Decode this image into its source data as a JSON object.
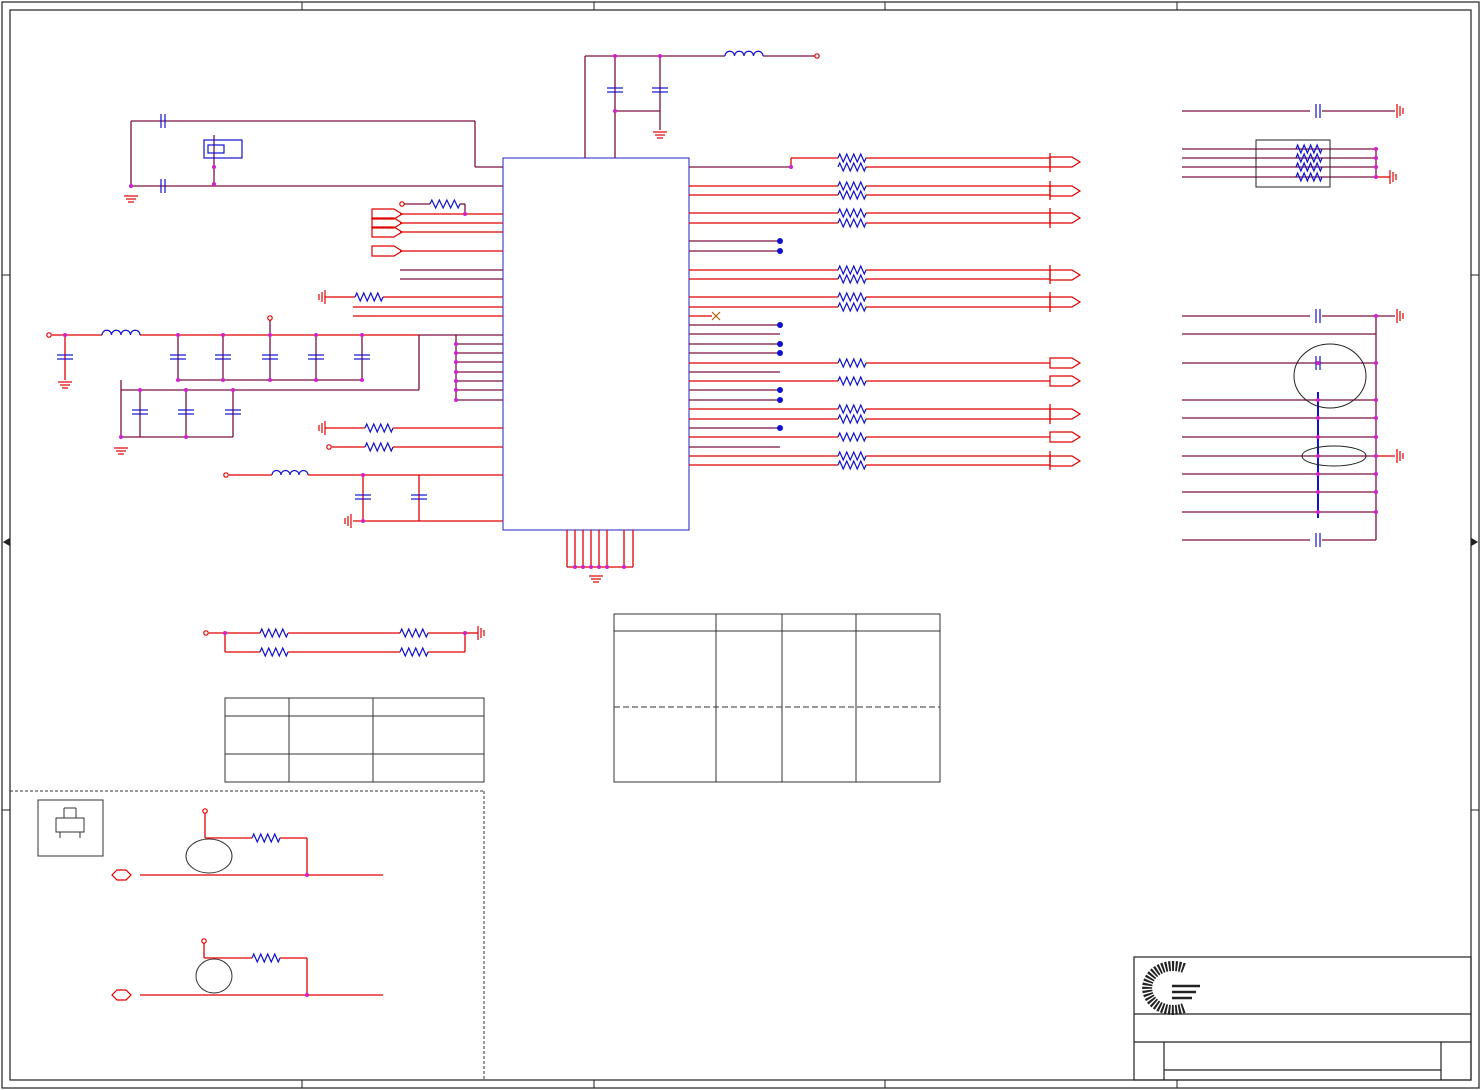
{
  "sheet": {
    "colors": {
      "wire": "#e00000",
      "net": "#7a1040",
      "part": "#1010d0",
      "junction": "#d020d0",
      "frame": "#222222",
      "ic_outline": "#2020c0"
    },
    "icons": [
      "ground-symbol",
      "resistor",
      "capacitor",
      "inductor",
      "crystal",
      "off-page-connector",
      "no-connect-mark",
      "company-logo"
    ]
  }
}
